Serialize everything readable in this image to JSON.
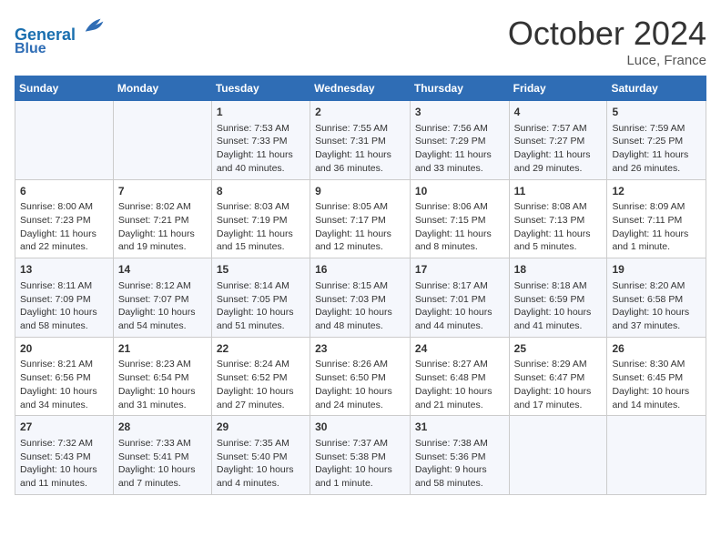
{
  "header": {
    "logo_line1": "General",
    "logo_line2": "Blue",
    "month_title": "October 2024",
    "location": "Luce, France"
  },
  "weekdays": [
    "Sunday",
    "Monday",
    "Tuesday",
    "Wednesday",
    "Thursday",
    "Friday",
    "Saturday"
  ],
  "weeks": [
    [
      {
        "day": "",
        "info": ""
      },
      {
        "day": "",
        "info": ""
      },
      {
        "day": "1",
        "info": "Sunrise: 7:53 AM\nSunset: 7:33 PM\nDaylight: 11 hours and 40 minutes."
      },
      {
        "day": "2",
        "info": "Sunrise: 7:55 AM\nSunset: 7:31 PM\nDaylight: 11 hours and 36 minutes."
      },
      {
        "day": "3",
        "info": "Sunrise: 7:56 AM\nSunset: 7:29 PM\nDaylight: 11 hours and 33 minutes."
      },
      {
        "day": "4",
        "info": "Sunrise: 7:57 AM\nSunset: 7:27 PM\nDaylight: 11 hours and 29 minutes."
      },
      {
        "day": "5",
        "info": "Sunrise: 7:59 AM\nSunset: 7:25 PM\nDaylight: 11 hours and 26 minutes."
      }
    ],
    [
      {
        "day": "6",
        "info": "Sunrise: 8:00 AM\nSunset: 7:23 PM\nDaylight: 11 hours and 22 minutes."
      },
      {
        "day": "7",
        "info": "Sunrise: 8:02 AM\nSunset: 7:21 PM\nDaylight: 11 hours and 19 minutes."
      },
      {
        "day": "8",
        "info": "Sunrise: 8:03 AM\nSunset: 7:19 PM\nDaylight: 11 hours and 15 minutes."
      },
      {
        "day": "9",
        "info": "Sunrise: 8:05 AM\nSunset: 7:17 PM\nDaylight: 11 hours and 12 minutes."
      },
      {
        "day": "10",
        "info": "Sunrise: 8:06 AM\nSunset: 7:15 PM\nDaylight: 11 hours and 8 minutes."
      },
      {
        "day": "11",
        "info": "Sunrise: 8:08 AM\nSunset: 7:13 PM\nDaylight: 11 hours and 5 minutes."
      },
      {
        "day": "12",
        "info": "Sunrise: 8:09 AM\nSunset: 7:11 PM\nDaylight: 11 hours and 1 minute."
      }
    ],
    [
      {
        "day": "13",
        "info": "Sunrise: 8:11 AM\nSunset: 7:09 PM\nDaylight: 10 hours and 58 minutes."
      },
      {
        "day": "14",
        "info": "Sunrise: 8:12 AM\nSunset: 7:07 PM\nDaylight: 10 hours and 54 minutes."
      },
      {
        "day": "15",
        "info": "Sunrise: 8:14 AM\nSunset: 7:05 PM\nDaylight: 10 hours and 51 minutes."
      },
      {
        "day": "16",
        "info": "Sunrise: 8:15 AM\nSunset: 7:03 PM\nDaylight: 10 hours and 48 minutes."
      },
      {
        "day": "17",
        "info": "Sunrise: 8:17 AM\nSunset: 7:01 PM\nDaylight: 10 hours and 44 minutes."
      },
      {
        "day": "18",
        "info": "Sunrise: 8:18 AM\nSunset: 6:59 PM\nDaylight: 10 hours and 41 minutes."
      },
      {
        "day": "19",
        "info": "Sunrise: 8:20 AM\nSunset: 6:58 PM\nDaylight: 10 hours and 37 minutes."
      }
    ],
    [
      {
        "day": "20",
        "info": "Sunrise: 8:21 AM\nSunset: 6:56 PM\nDaylight: 10 hours and 34 minutes."
      },
      {
        "day": "21",
        "info": "Sunrise: 8:23 AM\nSunset: 6:54 PM\nDaylight: 10 hours and 31 minutes."
      },
      {
        "day": "22",
        "info": "Sunrise: 8:24 AM\nSunset: 6:52 PM\nDaylight: 10 hours and 27 minutes."
      },
      {
        "day": "23",
        "info": "Sunrise: 8:26 AM\nSunset: 6:50 PM\nDaylight: 10 hours and 24 minutes."
      },
      {
        "day": "24",
        "info": "Sunrise: 8:27 AM\nSunset: 6:48 PM\nDaylight: 10 hours and 21 minutes."
      },
      {
        "day": "25",
        "info": "Sunrise: 8:29 AM\nSunset: 6:47 PM\nDaylight: 10 hours and 17 minutes."
      },
      {
        "day": "26",
        "info": "Sunrise: 8:30 AM\nSunset: 6:45 PM\nDaylight: 10 hours and 14 minutes."
      }
    ],
    [
      {
        "day": "27",
        "info": "Sunrise: 7:32 AM\nSunset: 5:43 PM\nDaylight: 10 hours and 11 minutes."
      },
      {
        "day": "28",
        "info": "Sunrise: 7:33 AM\nSunset: 5:41 PM\nDaylight: 10 hours and 7 minutes."
      },
      {
        "day": "29",
        "info": "Sunrise: 7:35 AM\nSunset: 5:40 PM\nDaylight: 10 hours and 4 minutes."
      },
      {
        "day": "30",
        "info": "Sunrise: 7:37 AM\nSunset: 5:38 PM\nDaylight: 10 hours and 1 minute."
      },
      {
        "day": "31",
        "info": "Sunrise: 7:38 AM\nSunset: 5:36 PM\nDaylight: 9 hours and 58 minutes."
      },
      {
        "day": "",
        "info": ""
      },
      {
        "day": "",
        "info": ""
      }
    ]
  ]
}
